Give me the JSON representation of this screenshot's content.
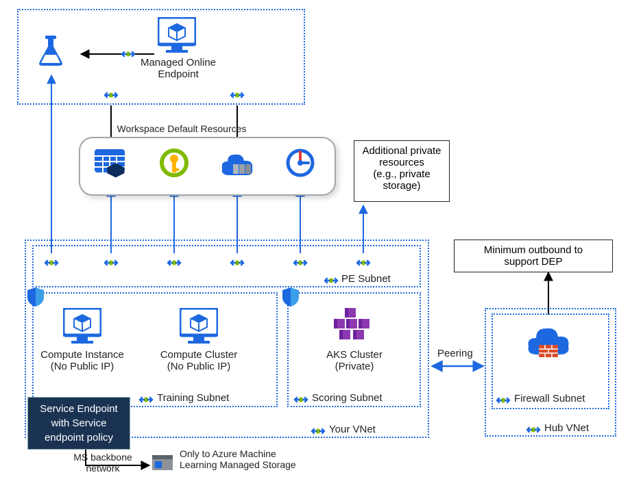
{
  "topbox": {
    "endpoint_label": "Managed Online\nEndpoint"
  },
  "workspace": {
    "title": "Workspace Default Resources"
  },
  "additional_private": "Additional private\nresources\n(e.g., private\nstorage)",
  "pe_subnet_label": "PE Subnet",
  "compute_instance": "Compute Instance\n(No Public IP)",
  "compute_cluster": "Compute Cluster\n(No Public IP)",
  "training_subnet": "Training Subnet",
  "aks_cluster": "AKS Cluster\n(Private)",
  "scoring_subnet": "Scoring Subnet",
  "your_vnet": "Your VNet",
  "peering": "Peering",
  "firewall_subnet": "Firewall Subnet",
  "hub_vnet": "Hub VNet",
  "min_outbound": "Minimum outbound to\nsupport DEP",
  "service_endpoint": "Service Endpoint\nwith  Service\nendpoint policy",
  "ms_backbone": "MS backbone\nnetwork",
  "only_to": "Only to Azure Machine\nLearning Managed Storage",
  "colors": {
    "azure_blue": "#1d68e0",
    "green": "#7fba00",
    "yellow": "#ffb300",
    "purple": "#8c39b2",
    "dark_badge": "#1b3353"
  }
}
